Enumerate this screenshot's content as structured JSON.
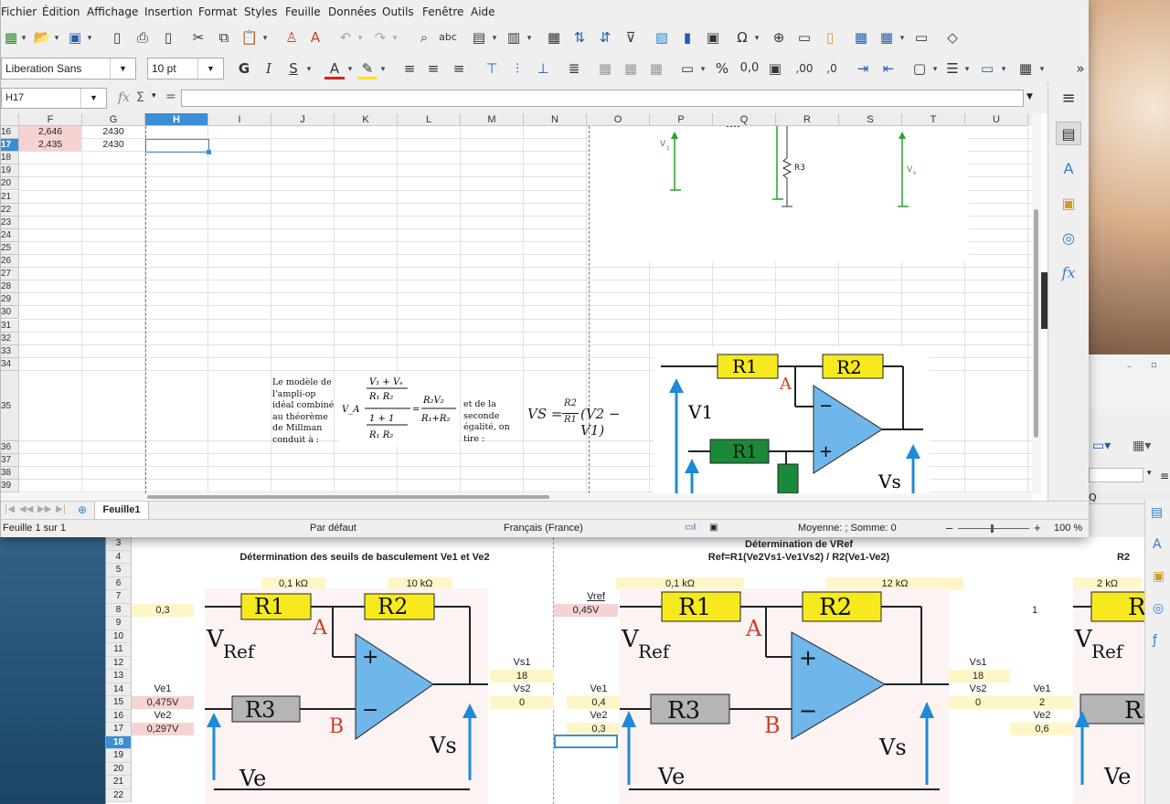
{
  "menu": [
    "Fichier",
    "Édition",
    "Affichage",
    "Insertion",
    "Format",
    "Styles",
    "Feuille",
    "Données",
    "Outils",
    "Fenêtre",
    "Aide"
  ],
  "font": {
    "name": "Liberation Sans",
    "size": "10 pt"
  },
  "fmt": {
    "bold": "G",
    "italic": "I",
    "underline": "S",
    "font_color": "A",
    "percent": "%",
    "number": "0,0",
    "dec_add": ",00",
    "dec_del": ",0"
  },
  "namebox": "H17",
  "fx": {
    "fx": "fx",
    "sigma": "Σ",
    "eq": "="
  },
  "columns": [
    "F",
    "G",
    "H",
    "I",
    "J",
    "K",
    "L",
    "M",
    "N",
    "O",
    "P",
    "Q",
    "R",
    "S",
    "T",
    "U"
  ],
  "rows": [
    "16",
    "17",
    "18",
    "19",
    "20",
    "21",
    "22",
    "23",
    "24",
    "25",
    "26",
    "27",
    "28",
    "29",
    "30",
    "31",
    "32",
    "33",
    "34",
    "35",
    "36",
    "37",
    "38",
    "39"
  ],
  "cells": {
    "f16": "2,646",
    "g16": "2430",
    "f17": "2,435",
    "g17": "2430"
  },
  "circuit_small": {
    "v1": "V",
    "v1sub": "1",
    "r3": "R3",
    "vs": "V",
    "vssub": "s"
  },
  "note1": {
    "l1": "Le modèle de",
    "l2": "l'ampli-op",
    "l3": "idéal combiné",
    "l4": "au théorème",
    "l5": "de Millman",
    "l6": "conduit à :"
  },
  "note2": {
    "l1": "et de la",
    "l2": "seconde",
    "l3": "égalité, on",
    "l4": "tire :"
  },
  "formula_va": "V_A",
  "formula_vs": {
    "lhs": "VS =",
    "num": "R2",
    "den": "R1",
    "rest": "(V2 − V1)"
  },
  "circuit_big": {
    "r1": "R1",
    "r2": "R2",
    "r1g": "R1",
    "a": "A",
    "v1": "V1",
    "vs": "Vs",
    "minus": "−",
    "plus": "+"
  },
  "tab": "Feuille1",
  "status": {
    "sheet": "Feuille 1 sur 1",
    "style": "Par défaut",
    "lang": "Français (France)",
    "sum": "Moyenne: ; Somme: 0",
    "zoom": "100 %"
  },
  "back": {
    "rows": [
      "3",
      "4",
      "5",
      "6",
      "7",
      "8",
      "9",
      "10",
      "11",
      "12",
      "13",
      "14",
      "15",
      "16",
      "17",
      "18",
      "19",
      "20",
      "21",
      "22"
    ],
    "title1": "Détermination des seuils de basculement Ve1 et Ve2",
    "title2": "Détermination de VRef",
    "title3": "Ref=R1(Ve2Vs1-Ve1Vs2) / R2(Ve1-Ve2)",
    "title4": "R2",
    "v1": "0,1 kΩ",
    "v2": "10 kΩ",
    "v3": "0,1 kΩ",
    "v4": "12 kΩ",
    "v5": "2 kΩ",
    "vref": "Vref",
    "vref_val": "0,3",
    "vref2": "Vref",
    "vref2_val": "0,45V",
    "one": "1",
    "ve1": "Ve1",
    "ve1_val": "0,475V",
    "ve2": "Ve2",
    "ve2_val": "0,297V",
    "vs1": "Vs1",
    "vs1_val": "18",
    "vs2": "Vs2",
    "vs2_val": "0",
    "b_ve1": "Ve1",
    "b_ve1_val": "0,4",
    "b_ve2": "Ve2",
    "b_ve2_val": "0,3",
    "c_vs1": "Vs1",
    "c_vs1_val": "18",
    "c_vs2": "Vs2",
    "c_vs2_val": "0",
    "c_ve1": "Ve1",
    "c_ve1_val": "2",
    "c_ve2": "Ve2",
    "c_ve2_val": "0,6",
    "col_q": "Q",
    "circ": {
      "r1": "R1",
      "r2": "R2",
      "r3": "R3",
      "a": "A",
      "b": "B",
      "vref": "V",
      "vrefsub": "Ref",
      "vs": "Vs",
      "ve": "Ve",
      "plus": "+",
      "minus": "−"
    }
  }
}
